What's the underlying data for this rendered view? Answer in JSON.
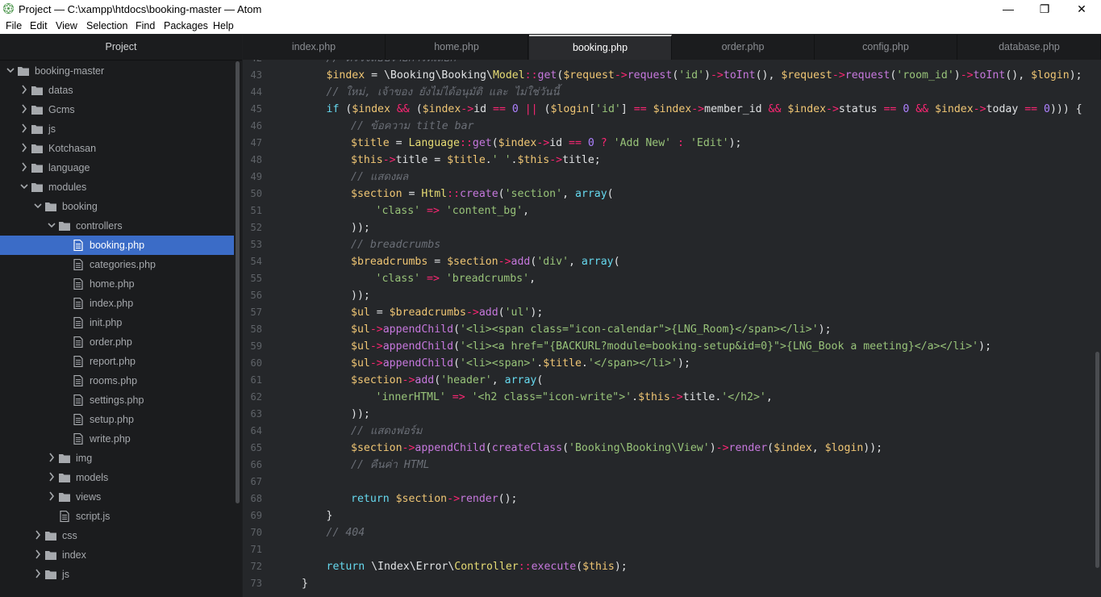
{
  "window": {
    "title": "Project — C:\\xampp\\htdocs\\booking-master — Atom",
    "minimize": "—",
    "maximize": "❐",
    "close": "✕"
  },
  "menu": [
    "File",
    "Edit",
    "View",
    "Selection",
    "Find",
    "Packages",
    "Help"
  ],
  "sidebar": {
    "title": "Project",
    "tree": [
      {
        "label": "booking-master",
        "type": "folder",
        "depth": 0,
        "expanded": true
      },
      {
        "label": "datas",
        "type": "folder",
        "depth": 1,
        "expanded": false
      },
      {
        "label": "Gcms",
        "type": "folder",
        "depth": 1,
        "expanded": false
      },
      {
        "label": "js",
        "type": "folder",
        "depth": 1,
        "expanded": false
      },
      {
        "label": "Kotchasan",
        "type": "folder",
        "depth": 1,
        "expanded": false
      },
      {
        "label": "language",
        "type": "folder",
        "depth": 1,
        "expanded": false
      },
      {
        "label": "modules",
        "type": "folder",
        "depth": 1,
        "expanded": true
      },
      {
        "label": "booking",
        "type": "folder",
        "depth": 2,
        "expanded": true
      },
      {
        "label": "controllers",
        "type": "folder",
        "depth": 3,
        "expanded": true
      },
      {
        "label": "booking.php",
        "type": "file",
        "depth": 4,
        "selected": true
      },
      {
        "label": "categories.php",
        "type": "file",
        "depth": 4
      },
      {
        "label": "home.php",
        "type": "file",
        "depth": 4
      },
      {
        "label": "index.php",
        "type": "file",
        "depth": 4
      },
      {
        "label": "init.php",
        "type": "file",
        "depth": 4
      },
      {
        "label": "order.php",
        "type": "file",
        "depth": 4
      },
      {
        "label": "report.php",
        "type": "file",
        "depth": 4
      },
      {
        "label": "rooms.php",
        "type": "file",
        "depth": 4
      },
      {
        "label": "settings.php",
        "type": "file",
        "depth": 4
      },
      {
        "label": "setup.php",
        "type": "file",
        "depth": 4
      },
      {
        "label": "write.php",
        "type": "file",
        "depth": 4
      },
      {
        "label": "img",
        "type": "folder",
        "depth": 3,
        "expanded": false
      },
      {
        "label": "models",
        "type": "folder",
        "depth": 3,
        "expanded": false
      },
      {
        "label": "views",
        "type": "folder",
        "depth": 3,
        "expanded": false
      },
      {
        "label": "script.js",
        "type": "file",
        "depth": 3
      },
      {
        "label": "css",
        "type": "folder",
        "depth": 2,
        "expanded": false
      },
      {
        "label": "index",
        "type": "folder",
        "depth": 2,
        "expanded": false
      },
      {
        "label": "js",
        "type": "folder",
        "depth": 2,
        "expanded": false
      }
    ]
  },
  "tabs": [
    {
      "label": "index.php",
      "active": false
    },
    {
      "label": "home.php",
      "active": false
    },
    {
      "label": "booking.php",
      "active": true
    },
    {
      "label": "order.php",
      "active": false
    },
    {
      "label": "config.php",
      "active": false
    },
    {
      "label": "database.php",
      "active": false
    }
  ],
  "editor": {
    "lines": [
      {
        "n": "42",
        "indent": 3,
        "tokens": [
          [
            "cm",
            "// ตรวจสอบรายการที่เลือก"
          ]
        ]
      },
      {
        "n": "43",
        "indent": 3,
        "tokens": [
          [
            "var",
            "$index"
          ],
          [
            "pl",
            " = \\Booking\\Booking\\"
          ],
          [
            "cls",
            "Model"
          ],
          [
            "op",
            "::"
          ],
          [
            "fn",
            "get"
          ],
          [
            "pl",
            "("
          ],
          [
            "var",
            "$request"
          ],
          [
            "op",
            "->"
          ],
          [
            "fn",
            "request"
          ],
          [
            "pl",
            "("
          ],
          [
            "str",
            "'id'"
          ],
          [
            "pl",
            ")"
          ],
          [
            "op",
            "->"
          ],
          [
            "fn",
            "toInt"
          ],
          [
            "pl",
            "(), "
          ],
          [
            "var",
            "$request"
          ],
          [
            "op",
            "->"
          ],
          [
            "fn",
            "request"
          ],
          [
            "pl",
            "("
          ],
          [
            "str",
            "'room_id'"
          ],
          [
            "pl",
            ")"
          ],
          [
            "op",
            "->"
          ],
          [
            "fn",
            "toInt"
          ],
          [
            "pl",
            "(), "
          ],
          [
            "var",
            "$login"
          ],
          [
            "pl",
            ");"
          ]
        ]
      },
      {
        "n": "44",
        "indent": 3,
        "tokens": [
          [
            "cm",
            "// ใหม่, เจ้าของ ยังไม่ได้อนุมัติ และ ไม่ใช่วันนี้"
          ]
        ]
      },
      {
        "n": "45",
        "indent": 3,
        "tokens": [
          [
            "kw",
            "if"
          ],
          [
            "pl",
            " ("
          ],
          [
            "var",
            "$index"
          ],
          [
            "op",
            " && "
          ],
          [
            "pl",
            "("
          ],
          [
            "var",
            "$index"
          ],
          [
            "op",
            "->"
          ],
          [
            "pl",
            "id "
          ],
          [
            "op",
            "=="
          ],
          [
            "num",
            " 0"
          ],
          [
            "op",
            " || "
          ],
          [
            "pl",
            "("
          ],
          [
            "var",
            "$login"
          ],
          [
            "pl",
            "["
          ],
          [
            "str",
            "'id'"
          ],
          [
            "pl",
            "] "
          ],
          [
            "op",
            "=="
          ],
          [
            "pl",
            " "
          ],
          [
            "var",
            "$index"
          ],
          [
            "op",
            "->"
          ],
          [
            "pl",
            "member_id "
          ],
          [
            "op",
            "&&"
          ],
          [
            "pl",
            " "
          ],
          [
            "var",
            "$index"
          ],
          [
            "op",
            "->"
          ],
          [
            "pl",
            "status "
          ],
          [
            "op",
            "=="
          ],
          [
            "num",
            " 0"
          ],
          [
            "op",
            " && "
          ],
          [
            "var",
            "$index"
          ],
          [
            "op",
            "->"
          ],
          [
            "pl",
            "today "
          ],
          [
            "op",
            "=="
          ],
          [
            "num",
            " 0"
          ],
          [
            "pl",
            ")))"
          ],
          [
            "pl",
            " {"
          ]
        ]
      },
      {
        "n": "46",
        "indent": 4,
        "tokens": [
          [
            "cm",
            "// ข้อความ title bar"
          ]
        ]
      },
      {
        "n": "47",
        "indent": 4,
        "tokens": [
          [
            "var",
            "$title"
          ],
          [
            "pl",
            " = "
          ],
          [
            "cls",
            "Language"
          ],
          [
            "op",
            "::"
          ],
          [
            "fn",
            "get"
          ],
          [
            "pl",
            "("
          ],
          [
            "var",
            "$index"
          ],
          [
            "op",
            "->"
          ],
          [
            "pl",
            "id "
          ],
          [
            "op",
            "=="
          ],
          [
            "num",
            " 0"
          ],
          [
            "op",
            " ? "
          ],
          [
            "str",
            "'Add New'"
          ],
          [
            "op",
            " : "
          ],
          [
            "str",
            "'Edit'"
          ],
          [
            "pl",
            ");"
          ]
        ]
      },
      {
        "n": "48",
        "indent": 4,
        "tokens": [
          [
            "var",
            "$this"
          ],
          [
            "op",
            "->"
          ],
          [
            "pl",
            "title = "
          ],
          [
            "var",
            "$title"
          ],
          [
            "pl",
            "."
          ],
          [
            "str",
            "' '"
          ],
          [
            "pl",
            "."
          ],
          [
            "var",
            "$this"
          ],
          [
            "op",
            "->"
          ],
          [
            "pl",
            "title;"
          ]
        ]
      },
      {
        "n": "49",
        "indent": 4,
        "tokens": [
          [
            "cm",
            "// แสดงผล"
          ]
        ]
      },
      {
        "n": "50",
        "indent": 4,
        "tokens": [
          [
            "var",
            "$section"
          ],
          [
            "pl",
            " = "
          ],
          [
            "cls",
            "Html"
          ],
          [
            "op",
            "::"
          ],
          [
            "fn",
            "create"
          ],
          [
            "pl",
            "("
          ],
          [
            "str",
            "'section'"
          ],
          [
            "pl",
            ", "
          ],
          [
            "kw",
            "array"
          ],
          [
            "pl",
            "("
          ]
        ]
      },
      {
        "n": "51",
        "indent": 5,
        "tokens": [
          [
            "str",
            "'class'"
          ],
          [
            "op",
            " => "
          ],
          [
            "str",
            "'content_bg'"
          ],
          [
            "pl",
            ","
          ]
        ]
      },
      {
        "n": "52",
        "indent": 4,
        "tokens": [
          [
            "pl",
            "));"
          ]
        ]
      },
      {
        "n": "53",
        "indent": 4,
        "tokens": [
          [
            "cm",
            "// breadcrumbs"
          ]
        ]
      },
      {
        "n": "54",
        "indent": 4,
        "tokens": [
          [
            "var",
            "$breadcrumbs"
          ],
          [
            "pl",
            " = "
          ],
          [
            "var",
            "$section"
          ],
          [
            "op",
            "->"
          ],
          [
            "fn",
            "add"
          ],
          [
            "pl",
            "("
          ],
          [
            "str",
            "'div'"
          ],
          [
            "pl",
            ", "
          ],
          [
            "kw",
            "array"
          ],
          [
            "pl",
            "("
          ]
        ]
      },
      {
        "n": "55",
        "indent": 5,
        "tokens": [
          [
            "str",
            "'class'"
          ],
          [
            "op",
            " => "
          ],
          [
            "str",
            "'breadcrumbs'"
          ],
          [
            "pl",
            ","
          ]
        ]
      },
      {
        "n": "56",
        "indent": 4,
        "tokens": [
          [
            "pl",
            "));"
          ]
        ]
      },
      {
        "n": "57",
        "indent": 4,
        "tokens": [
          [
            "var",
            "$ul"
          ],
          [
            "pl",
            " = "
          ],
          [
            "var",
            "$breadcrumbs"
          ],
          [
            "op",
            "->"
          ],
          [
            "fn",
            "add"
          ],
          [
            "pl",
            "("
          ],
          [
            "str",
            "'ul'"
          ],
          [
            "pl",
            ");"
          ]
        ]
      },
      {
        "n": "58",
        "indent": 4,
        "tokens": [
          [
            "var",
            "$ul"
          ],
          [
            "op",
            "->"
          ],
          [
            "fn",
            "appendChild"
          ],
          [
            "pl",
            "("
          ],
          [
            "str",
            "'<li><span class=\"icon-calendar\">{LNG_Room}</span></li>'"
          ],
          [
            "pl",
            ");"
          ]
        ]
      },
      {
        "n": "59",
        "indent": 4,
        "tokens": [
          [
            "var",
            "$ul"
          ],
          [
            "op",
            "->"
          ],
          [
            "fn",
            "appendChild"
          ],
          [
            "pl",
            "("
          ],
          [
            "str",
            "'<li><a href=\"{BACKURL?module=booking-setup&id=0}\">{LNG_Book a meeting}</a></li>'"
          ],
          [
            "pl",
            ");"
          ]
        ]
      },
      {
        "n": "60",
        "indent": 4,
        "tokens": [
          [
            "var",
            "$ul"
          ],
          [
            "op",
            "->"
          ],
          [
            "fn",
            "appendChild"
          ],
          [
            "pl",
            "("
          ],
          [
            "str",
            "'<li><span>'"
          ],
          [
            "pl",
            "."
          ],
          [
            "var",
            "$title"
          ],
          [
            "pl",
            "."
          ],
          [
            "str",
            "'</span></li>'"
          ],
          [
            "pl",
            ");"
          ]
        ]
      },
      {
        "n": "61",
        "indent": 4,
        "tokens": [
          [
            "var",
            "$section"
          ],
          [
            "op",
            "->"
          ],
          [
            "fn",
            "add"
          ],
          [
            "pl",
            "("
          ],
          [
            "str",
            "'header'"
          ],
          [
            "pl",
            ", "
          ],
          [
            "kw",
            "array"
          ],
          [
            "pl",
            "("
          ]
        ]
      },
      {
        "n": "62",
        "indent": 5,
        "tokens": [
          [
            "str",
            "'innerHTML'"
          ],
          [
            "op",
            " => "
          ],
          [
            "str",
            "'<h2 class=\"icon-write\">'"
          ],
          [
            "pl",
            "."
          ],
          [
            "var",
            "$this"
          ],
          [
            "op",
            "->"
          ],
          [
            "pl",
            "title."
          ],
          [
            "str",
            "'</h2>'"
          ],
          [
            "pl",
            ","
          ]
        ]
      },
      {
        "n": "63",
        "indent": 4,
        "tokens": [
          [
            "pl",
            "));"
          ]
        ]
      },
      {
        "n": "64",
        "indent": 4,
        "tokens": [
          [
            "cm",
            "// แสดงฟอร์ม"
          ]
        ]
      },
      {
        "n": "65",
        "indent": 4,
        "tokens": [
          [
            "var",
            "$section"
          ],
          [
            "op",
            "->"
          ],
          [
            "fn",
            "appendChild"
          ],
          [
            "pl",
            "("
          ],
          [
            "fn",
            "createClass"
          ],
          [
            "pl",
            "("
          ],
          [
            "str",
            "'Booking\\Booking\\View'"
          ],
          [
            "pl",
            ")"
          ],
          [
            "op",
            "->"
          ],
          [
            "fn",
            "render"
          ],
          [
            "pl",
            "("
          ],
          [
            "var",
            "$index"
          ],
          [
            "pl",
            ", "
          ],
          [
            "var",
            "$login"
          ],
          [
            "pl",
            "));"
          ]
        ]
      },
      {
        "n": "66",
        "indent": 4,
        "tokens": [
          [
            "cm",
            "// คืนค่า HTML"
          ]
        ]
      },
      {
        "n": "67",
        "indent": 0,
        "tokens": []
      },
      {
        "n": "68",
        "indent": 4,
        "tokens": [
          [
            "kw",
            "return"
          ],
          [
            "pl",
            " "
          ],
          [
            "var",
            "$section"
          ],
          [
            "op",
            "->"
          ],
          [
            "fn",
            "render"
          ],
          [
            "pl",
            "();"
          ]
        ]
      },
      {
        "n": "69",
        "indent": 3,
        "tokens": [
          [
            "pl",
            "}"
          ]
        ]
      },
      {
        "n": "70",
        "indent": 3,
        "tokens": [
          [
            "cm",
            "// 404"
          ]
        ]
      },
      {
        "n": "71",
        "indent": 0,
        "tokens": []
      },
      {
        "n": "72",
        "indent": 3,
        "tokens": [
          [
            "kw",
            "return"
          ],
          [
            "pl",
            " \\Index\\Error\\"
          ],
          [
            "cls",
            "Controller"
          ],
          [
            "op",
            "::"
          ],
          [
            "fn",
            "execute"
          ],
          [
            "pl",
            "("
          ],
          [
            "var",
            "$this"
          ],
          [
            "pl",
            ");"
          ]
        ]
      },
      {
        "n": "73",
        "indent": 2,
        "tokens": [
          [
            "pl",
            "}"
          ]
        ]
      }
    ]
  }
}
